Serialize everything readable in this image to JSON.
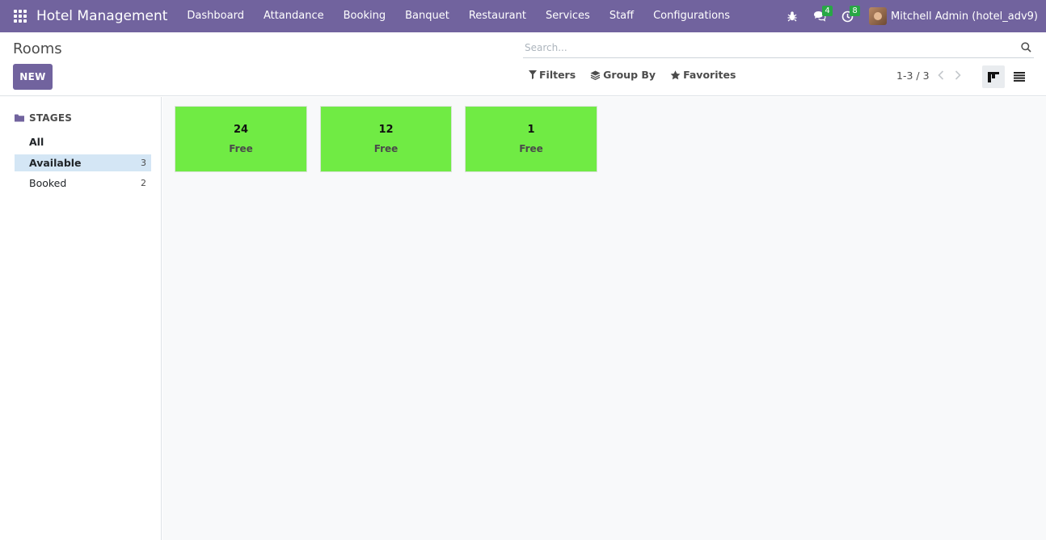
{
  "navbar": {
    "brand": "Hotel Management",
    "menu": [
      "Dashboard",
      "Attandance",
      "Booking",
      "Banquet",
      "Restaurant",
      "Services",
      "Staff",
      "Configurations"
    ],
    "messages_count": "4",
    "activities_count": "8",
    "user": "Mitchell Admin (hotel_adv9)"
  },
  "control_panel": {
    "title": "Rooms",
    "new_label": "NEW",
    "search_placeholder": "Search...",
    "filters_label": "Filters",
    "group_by_label": "Group By",
    "favorites_label": "Favorites",
    "pager": "1-3 / 3"
  },
  "sidebar": {
    "header": "STAGES",
    "items": [
      {
        "label": "All",
        "count": ""
      },
      {
        "label": "Available",
        "count": "3"
      },
      {
        "label": "Booked",
        "count": "2"
      }
    ]
  },
  "rooms": [
    {
      "number": "24",
      "status": "Free"
    },
    {
      "number": "12",
      "status": "Free"
    },
    {
      "number": "1",
      "status": "Free"
    }
  ],
  "colors": {
    "brand": "#71639e",
    "room_free": "#70eb44",
    "stage_active": "#d4e6f5",
    "badge": "#28a745"
  }
}
